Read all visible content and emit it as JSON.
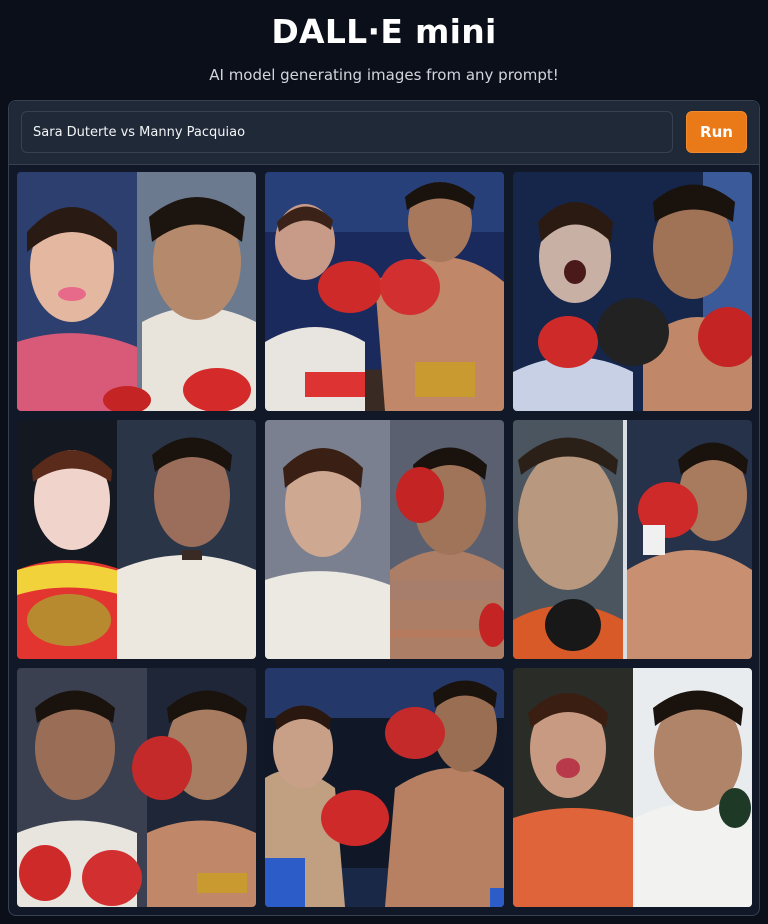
{
  "header": {
    "title": "DALL·E mini",
    "subtitle": "AI model generating images from any prompt!"
  },
  "prompt": {
    "value": "Sara Duterte vs Manny Pacquiao",
    "placeholder": ""
  },
  "toolbar": {
    "run_label": "Run"
  },
  "colors": {
    "background": "#0b0f19",
    "panel": "#111827",
    "input": "#1f2937",
    "accent": "#ea7a17"
  },
  "gallery": {
    "columns": 3,
    "rows": 3,
    "images": [
      {
        "subject": "two faces side by side, woman left, man right with boxing glove"
      },
      {
        "subject": "woman and boxer exchanging punches with red gloves"
      },
      {
        "subject": "woman and boxer face to face with gloves"
      },
      {
        "subject": "woman with championship belt, man in barong"
      },
      {
        "subject": "woman in white, boxer with red gloves in ring"
      },
      {
        "subject": "close-up man with microphone, boxer punching"
      },
      {
        "subject": "two men in boxing pose with red gloves"
      },
      {
        "subject": "fighter punching in arena"
      },
      {
        "subject": "woman in orange, man in white shirt"
      }
    ]
  }
}
